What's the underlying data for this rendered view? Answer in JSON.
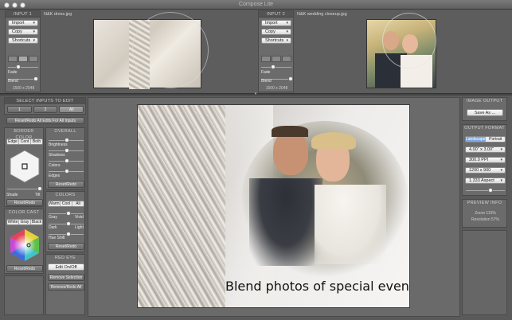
{
  "window": {
    "title": "Compose Lite"
  },
  "input1": {
    "header": "INPUT 1",
    "import": "Import",
    "copy": "Copy",
    "shortcuts": "Shortcuts",
    "filename": "N&K dress.jpg",
    "fade_label": "Fade",
    "blend_label": "Blend",
    "size": "1500 x 2048"
  },
  "input2": {
    "header": "INPUT 2",
    "import": "Import",
    "copy": "Copy",
    "shortcuts": "Shortcuts",
    "filename": "N&K wedding closeup.jpg",
    "fade_label": "Fade",
    "blend_label": "Blend",
    "size": "1500 x 2048"
  },
  "left": {
    "select_header": "SELECT INPUTS TO EDIT",
    "input_one": "1",
    "input_two": "2",
    "all": "All",
    "reset_all": "Reset/Redo All Edits For All Inputs",
    "border_header": "BORDER COLOR",
    "border_modes": [
      "Edge",
      "Cent",
      "Both"
    ],
    "shade": "Shade",
    "tilt": "Tilt",
    "border_reset": "Reset/Redo",
    "colorcast_header": "COLOR CAST",
    "colorcast_modes": [
      "White",
      "Gray",
      "Black"
    ],
    "colorcast_reset": "Reset/Redo"
  },
  "middle": {
    "overall_header": "OVERALL",
    "brightness": "Brightness",
    "shadows": "Shadows",
    "colors": "Colors",
    "edges": "Edges",
    "overall_reset": "Reset/Redo",
    "colors_header": "COLORS",
    "tone_modes": [
      "Warm",
      "Cool",
      "All"
    ],
    "gray": "Gray",
    "vivid": "Vivid",
    "dark": "Dark",
    "light": "Light",
    "hue_shift": "Hue Shift",
    "colors_reset": "Reset/Redo",
    "redeye_header": "RED EYE",
    "edit_onoff": "Edit On/Off",
    "remove_selection": "Remove Selection",
    "remove_all": "Remove/Redo All"
  },
  "canvas": {
    "caption": "Blend photos of special events"
  },
  "right": {
    "output_header": "IMAGE OUTPUT",
    "save": "Save As ...",
    "format_header": "OUTPUT FORMAT",
    "orientation": [
      "Landscape",
      "Portrait"
    ],
    "size_in": "4.00\" x 3.00\"",
    "ppi": "300.0 PPI",
    "pixels": "1200 x 900",
    "aspect": "1.333 Aspect",
    "preview_header": "PREVIEW INFO",
    "zoom": "Zoom 115%",
    "resolution": "Resolution 57%"
  },
  "colors": {
    "accent": "#7aa7e8",
    "bg": "#5a5a5a",
    "panel": "#6b6b6b"
  }
}
